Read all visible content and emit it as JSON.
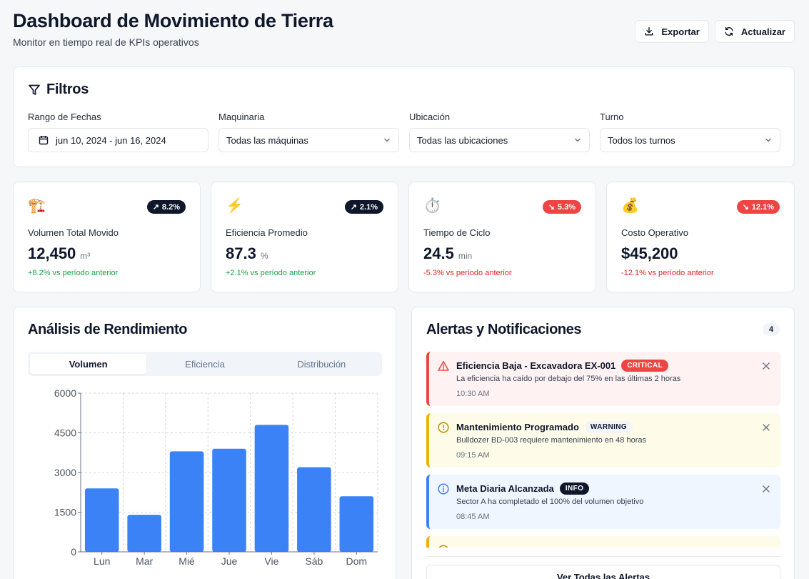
{
  "header": {
    "title": "Dashboard de Movimiento de Tierra",
    "subtitle": "Monitor en tiempo real de KPIs operativos",
    "export_label": "Exportar",
    "refresh_label": "Actualizar"
  },
  "filters": {
    "title": "Filtros",
    "date": {
      "label": "Rango de Fechas",
      "value": "jun 10, 2024 - jun 16, 2024"
    },
    "machinery": {
      "label": "Maquinaria",
      "value": "Todas las máquinas"
    },
    "location": {
      "label": "Ubicación",
      "value": "Todas las ubicaciones"
    },
    "shift": {
      "label": "Turno",
      "value": "Todos los turnos"
    }
  },
  "kpis": [
    {
      "emoji": "🏗️",
      "badge": "8.2%",
      "trend": "up",
      "label": "Volumen Total Movido",
      "value": "12,450",
      "unit": "m³",
      "change": "+8.2% vs período anterior"
    },
    {
      "emoji": "⚡",
      "badge": "2.1%",
      "trend": "up",
      "label": "Eficiencia Promedio",
      "value": "87.3",
      "unit": "%",
      "change": "+2.1% vs período anterior"
    },
    {
      "emoji": "⏱️",
      "badge": "5.3%",
      "trend": "down",
      "label": "Tiempo de Ciclo",
      "value": "24.5",
      "unit": "min",
      "change": "-5.3% vs período anterior"
    },
    {
      "emoji": "💰",
      "badge": "12.1%",
      "trend": "down",
      "label": "Costo Operativo",
      "value": "$45,200",
      "unit": "",
      "change": "-12.1% vs período anterior"
    }
  ],
  "performance": {
    "title": "Análisis de Rendimiento",
    "tabs": [
      "Volumen",
      "Eficiencia",
      "Distribución"
    ],
    "active_tab": "Volumen"
  },
  "chart_data": {
    "type": "bar",
    "categories": [
      "Lun",
      "Mar",
      "Mié",
      "Jue",
      "Vie",
      "Sáb",
      "Dom"
    ],
    "values": [
      2400,
      1400,
      3800,
      3900,
      4800,
      3200,
      2100
    ],
    "yticks": [
      0,
      1500,
      3000,
      4500,
      6000
    ],
    "ylim": [
      0,
      6000
    ],
    "grid": true,
    "color": "#3b82f6"
  },
  "alerts": {
    "title": "Alertas y Notificaciones",
    "count": "4",
    "items": [
      {
        "level": "critical",
        "title": "Eficiencia Baja - Excavadora EX-001",
        "badge": "CRITICAL",
        "message": "La eficiencia ha caído por debajo del 75% en las últimas 2 horas",
        "time": "10:30 AM"
      },
      {
        "level": "warning",
        "title": "Mantenimiento Programado",
        "badge": "WARNING",
        "message": "Bulldozer BD-003 requiere mantenimiento en 48 horas",
        "time": "09:15 AM"
      },
      {
        "level": "info",
        "title": "Meta Diaria Alcanzada",
        "badge": "INFO",
        "message": "Sector A ha completado el 100% del volumen objetivo",
        "time": "08:45 AM"
      },
      {
        "level": "warning",
        "title": "",
        "badge": "",
        "message": "",
        "time": ""
      }
    ],
    "view_all_label": "Ver Todas las Alertas"
  },
  "colors": {
    "accent": "#3b82f6",
    "critical": "#ef4444",
    "warning": "#eab308",
    "info": "#3b82f6",
    "positive": "#16a34a",
    "negative": "#dc2626"
  }
}
